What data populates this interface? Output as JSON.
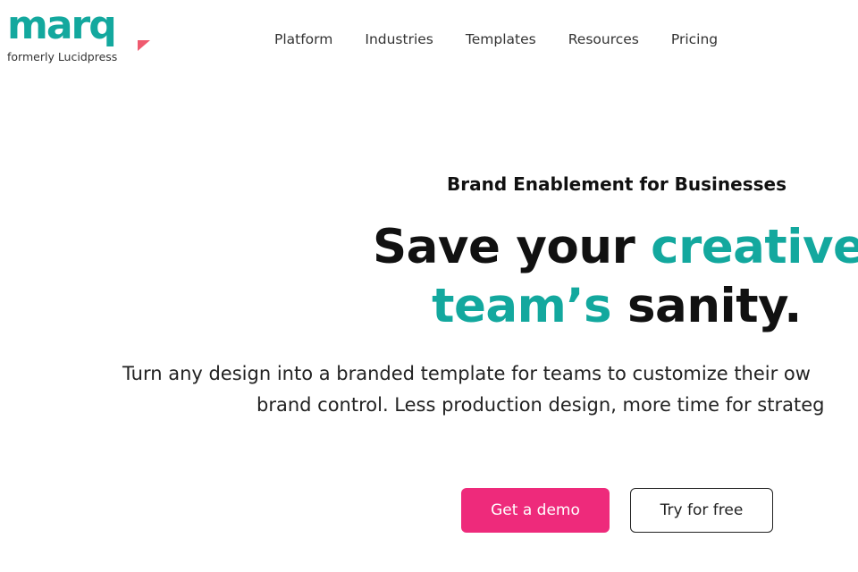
{
  "logo": {
    "word": "marq",
    "subtitle": "formerly Lucidpress"
  },
  "nav": [
    "Platform",
    "Industries",
    "Templates",
    "Resources",
    "Pricing"
  ],
  "hero": {
    "eyebrow": "Brand Enablement for Businesses",
    "line1_dark": "Save your ",
    "line1_teal": "creative",
    "line2_teal": "team’s",
    "line2_dark": " sanity.",
    "paragraph_line1": "Turn any design into a branded template for teams to customize their ow",
    "paragraph_line2": "brand control. Less production design, more time for strateg"
  },
  "buttons": {
    "demo": "Get a demo",
    "free": "Try for free"
  },
  "colors": {
    "teal": "#13a89e",
    "pink": "#ee2a7b"
  }
}
